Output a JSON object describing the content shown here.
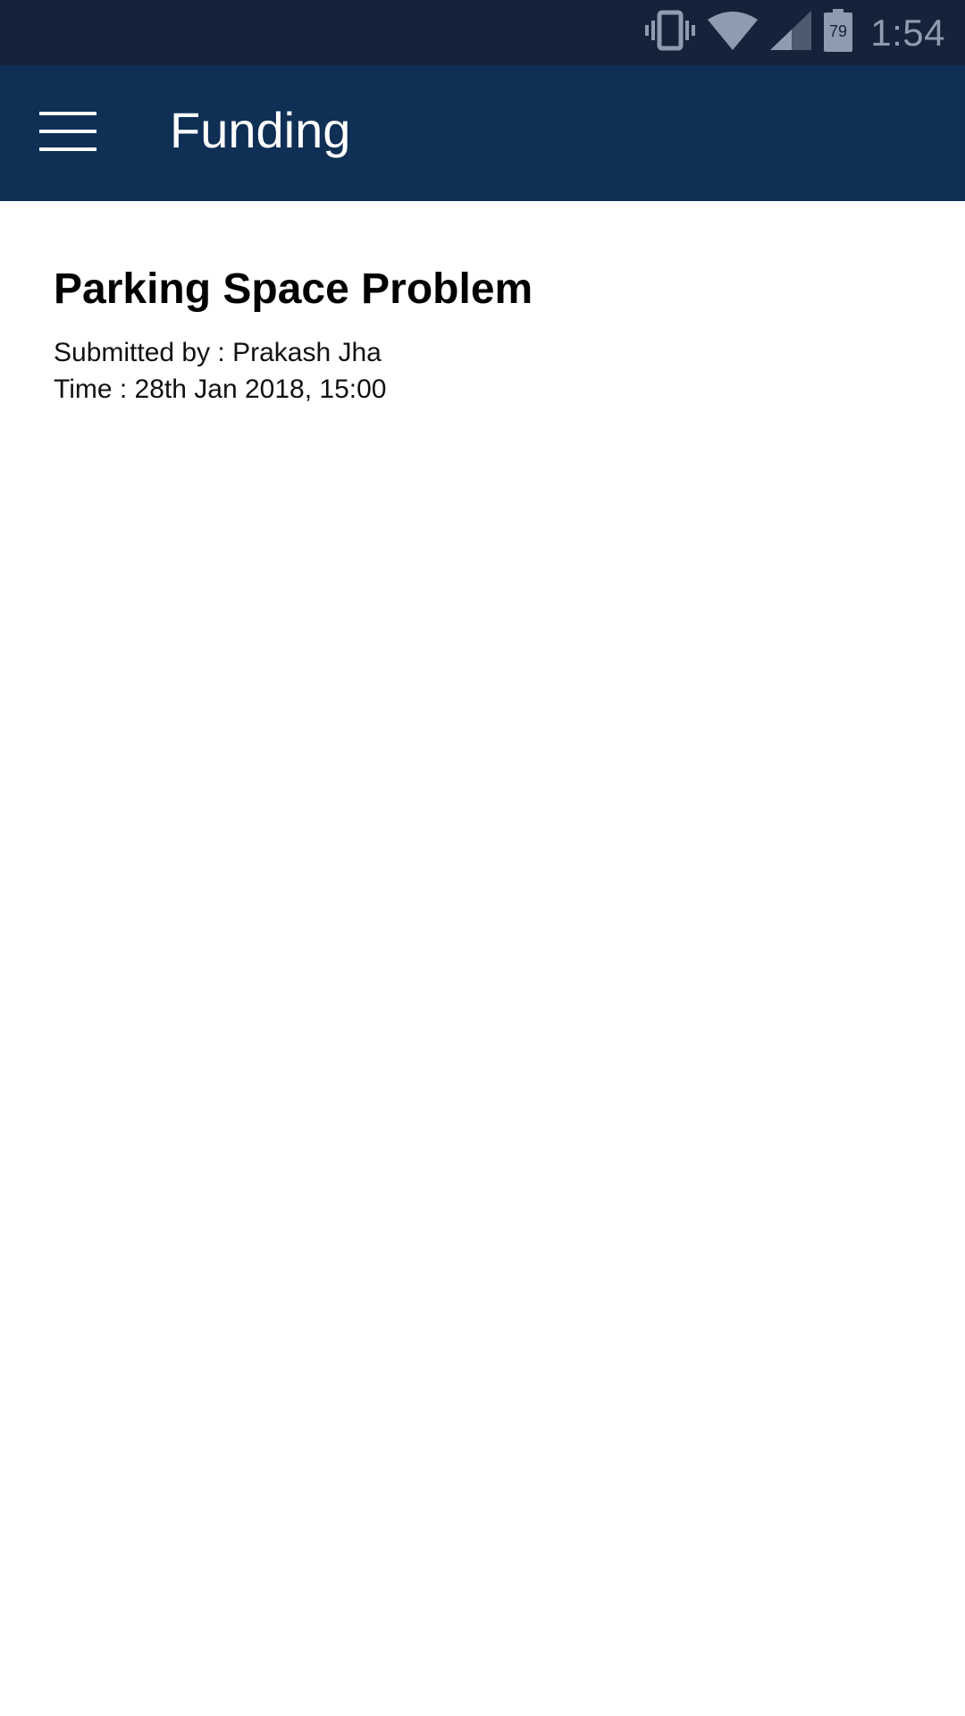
{
  "status_bar": {
    "time": "1:54",
    "battery_level": "79",
    "icons": [
      "vibrate-icon",
      "wifi-icon",
      "cell-signal-icon",
      "battery-icon"
    ],
    "text_color": "#8f9bb0",
    "background": "#162239"
  },
  "app_bar": {
    "title": "Funding",
    "menu_icon": "hamburger-menu-icon",
    "background": "#0f2f55"
  },
  "post": {
    "title": "Parking Space Problem",
    "submitted_by": "Submitted by : Prakash Jha",
    "time": "Time : 28th Jan 2018, 15:00"
  }
}
